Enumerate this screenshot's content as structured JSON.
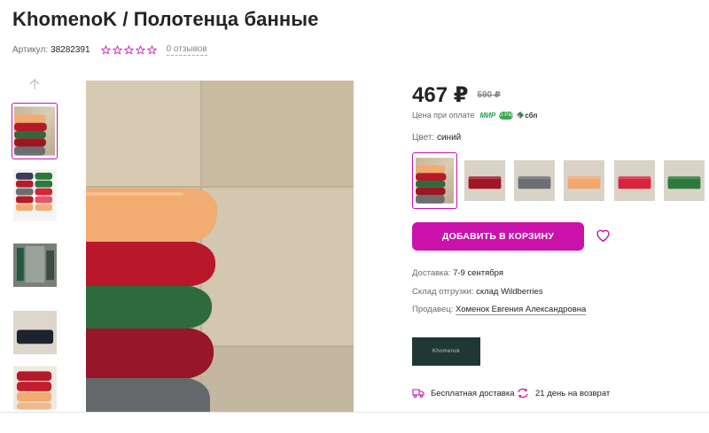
{
  "product": {
    "title": "KhomenoK / Полотенца банные",
    "article_label": "Артикул:",
    "article_value": "38282391",
    "rating_stars": 0,
    "reviews": "0 отзывов"
  },
  "price": {
    "current": "467 ₽",
    "old": "590 ₽",
    "payment_label": "Цена при оплате",
    "payment_methods": [
      "МИР",
      "G Pay",
      "сбп"
    ]
  },
  "color": {
    "label": "Цвет:",
    "value": "синий"
  },
  "actions": {
    "add_to_cart": "ДОБАВИТЬ В КОРЗИНУ"
  },
  "delivery": {
    "label": "Доставка:",
    "value": "7-9 сентября",
    "warehouse_label": "Склад отгрузки:",
    "warehouse_value": "склад Wildberries",
    "seller_label": "Продавец:",
    "seller_value": "Хоменок Евгения Александровна"
  },
  "brand": {
    "logo_text": "Khomenok"
  },
  "perks": {
    "free_delivery": "Бесплатная доставка",
    "returns": "21 день на возврат"
  },
  "colors": {
    "accent": "#cb11ab",
    "brand_logo_bg": "#1f3735"
  }
}
